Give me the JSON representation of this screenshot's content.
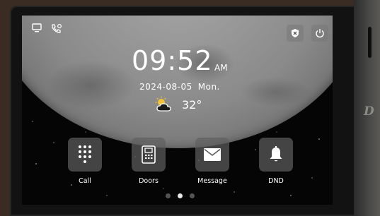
{
  "status": {
    "left_icons": [
      "monitor-icon",
      "phone-call-icon"
    ],
    "right_buttons": [
      "security-shield-icon",
      "power-icon"
    ]
  },
  "clock": {
    "time": "09:52",
    "ampm": "AM",
    "date": "2024-08-05",
    "weekday": "Mon."
  },
  "weather": {
    "icon": "partly-cloudy-icon",
    "temperature": "32°"
  },
  "apps": [
    {
      "label": "Call",
      "icon": "keypad-icon"
    },
    {
      "label": "Doors",
      "icon": "door-panel-icon"
    },
    {
      "label": "Message",
      "icon": "envelope-icon"
    },
    {
      "label": "DND",
      "icon": "bell-icon"
    }
  ],
  "pager": {
    "pages": 3,
    "active_index": 1
  },
  "brand": {
    "letter": "D"
  },
  "colors": {
    "screen_bg": "#050505",
    "tile_bg": "#5f5f5f",
    "text": "#ffffff"
  }
}
